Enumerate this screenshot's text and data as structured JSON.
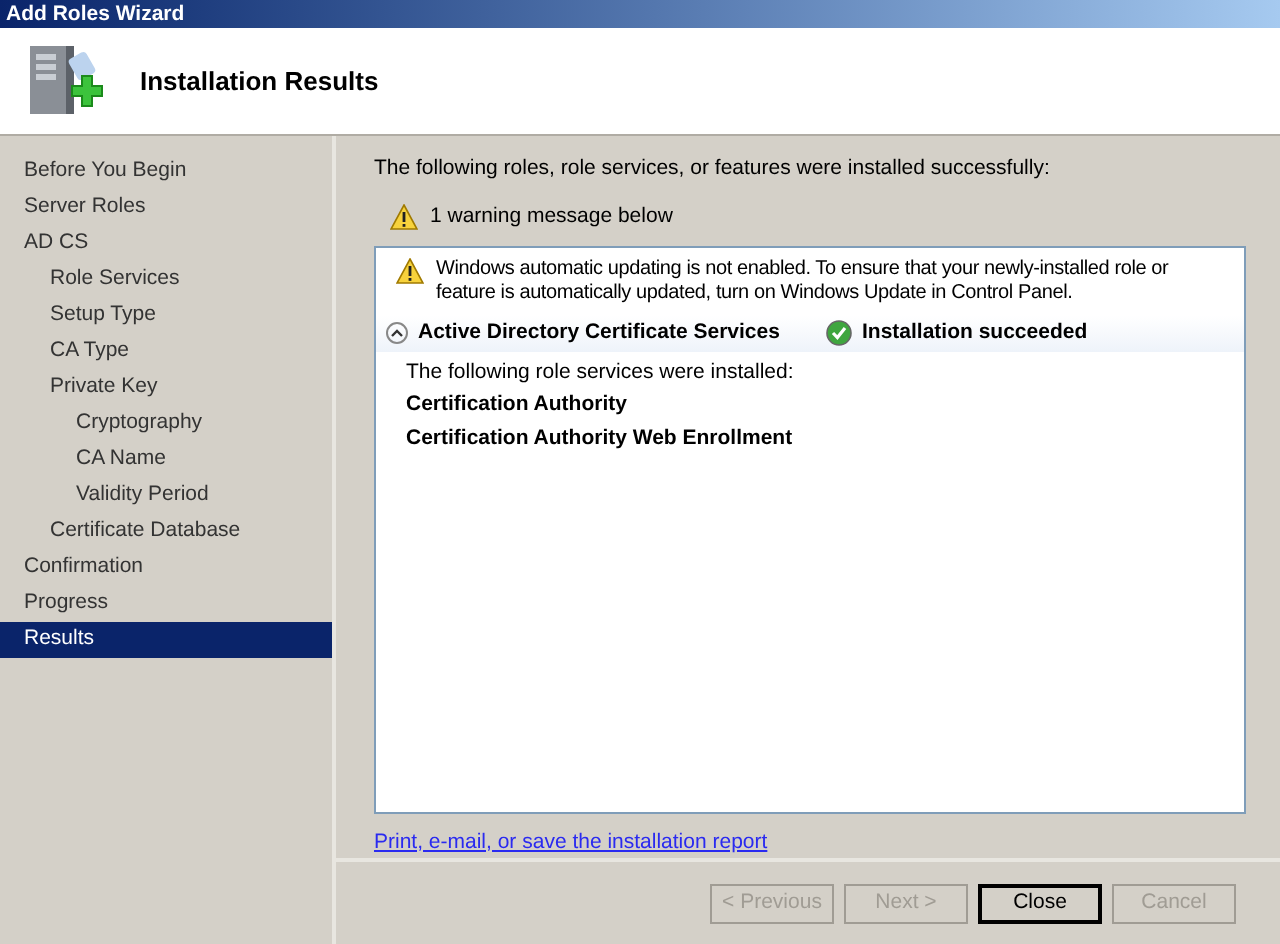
{
  "window": {
    "title": "Add Roles Wizard"
  },
  "header": {
    "title": "Installation Results"
  },
  "sidebar": {
    "items": [
      {
        "label": "Before You Begin",
        "selected": false
      },
      {
        "label": "Server Roles",
        "selected": false
      },
      {
        "label": "AD CS",
        "selected": false,
        "children": [
          {
            "label": "Role Services",
            "selected": false
          },
          {
            "label": "Setup Type",
            "selected": false
          },
          {
            "label": "CA Type",
            "selected": false
          },
          {
            "label": "Private Key",
            "selected": false,
            "children": [
              {
                "label": "Cryptography",
                "selected": false
              },
              {
                "label": "CA Name",
                "selected": false
              },
              {
                "label": "Validity Period",
                "selected": false
              }
            ]
          },
          {
            "label": "Certificate Database",
            "selected": false
          }
        ]
      },
      {
        "label": "Confirmation",
        "selected": false
      },
      {
        "label": "Progress",
        "selected": false
      },
      {
        "label": "Results",
        "selected": true
      }
    ]
  },
  "content": {
    "intro": "The following roles, role services, or features were installed successfully:",
    "warning_count": "1 warning message below",
    "results": {
      "warning": "Windows automatic updating is not enabled. To ensure that your newly-installed role or feature is automatically updated, turn on Windows Update in Control Panel.",
      "roles": [
        {
          "name": "Active Directory Certificate Services",
          "expanded": true,
          "status": "Installation succeeded",
          "details": "The following role services were installed:",
          "services": [
            "Certification Authority",
            "Certification Authority Web Enrollment"
          ]
        }
      ]
    },
    "link": "Print, e-mail, or save the installation report"
  },
  "buttons": [
    {
      "label": "< Previous",
      "disabled": true,
      "default": false
    },
    {
      "label": "Next >",
      "disabled": true,
      "default": false
    },
    {
      "label": "Close",
      "disabled": false,
      "default": true
    },
    {
      "label": "Cancel",
      "disabled": true,
      "default": false
    }
  ]
}
